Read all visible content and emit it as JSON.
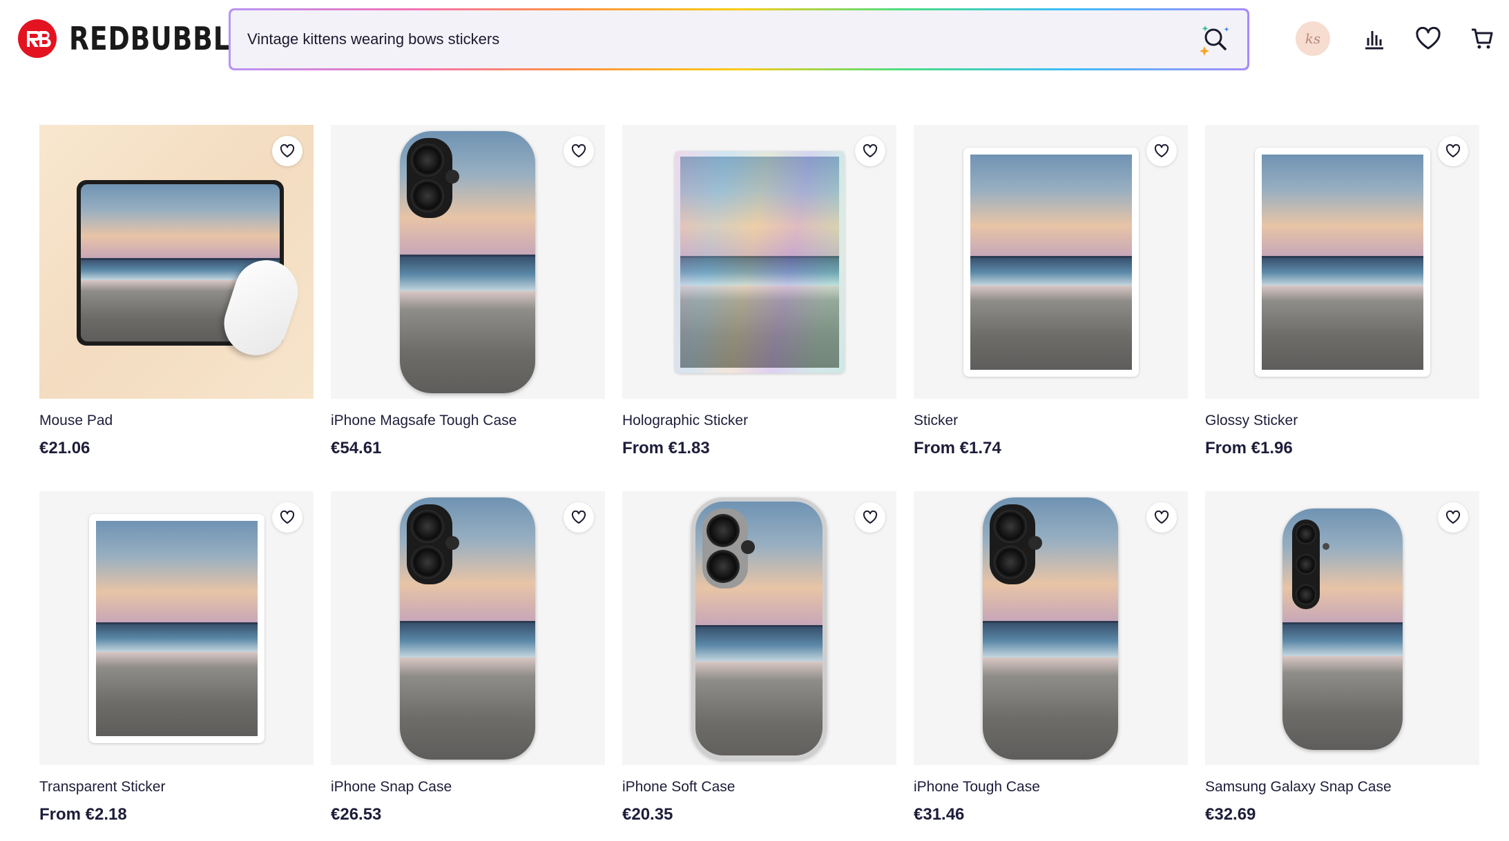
{
  "brand": {
    "name": "REDBUBBLE",
    "color": "#e41321"
  },
  "search": {
    "value": "Vintage kittens wearing bows stickers",
    "icon": "ai-search-icon"
  },
  "header_icons": {
    "avatar_initials": "ks",
    "icons": [
      "chart-bars-icon",
      "heart-icon",
      "cart-icon"
    ]
  },
  "products": [
    {
      "title": "Mouse Pad",
      "price": "€21.06",
      "type": "mousepad"
    },
    {
      "title": "iPhone Magsafe Tough Case",
      "price": "€54.61",
      "type": "phone-tough"
    },
    {
      "title": "Holographic Sticker",
      "price": "From €1.83",
      "type": "holo"
    },
    {
      "title": "Sticker",
      "price": "From €1.74",
      "type": "sticker"
    },
    {
      "title": "Glossy Sticker",
      "price": "From €1.96",
      "type": "sticker"
    },
    {
      "title": "Transparent Sticker",
      "price": "From €2.18",
      "type": "sticker"
    },
    {
      "title": "iPhone Snap Case",
      "price": "€26.53",
      "type": "phone-snap"
    },
    {
      "title": "iPhone Soft Case",
      "price": "€20.35",
      "type": "phone-soft"
    },
    {
      "title": "iPhone Tough Case",
      "price": "€31.46",
      "type": "phone-tough"
    },
    {
      "title": "Samsung Galaxy Snap Case",
      "price": "€32.69",
      "type": "phone-samsung"
    }
  ]
}
